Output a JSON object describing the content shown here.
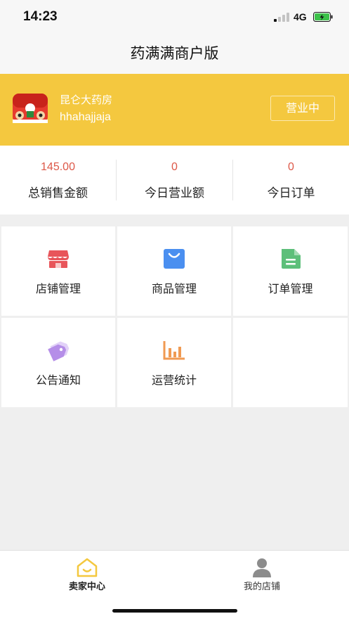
{
  "status_bar": {
    "time": "14:23",
    "network": "4G"
  },
  "nav": {
    "title": "药满满商户版"
  },
  "store": {
    "name": "昆仑大药房",
    "account": "hhahajjaja",
    "status_button": "营业中"
  },
  "stats": [
    {
      "value": "145.00",
      "label": "总销售金额"
    },
    {
      "value": "0",
      "label": "今日营业额"
    },
    {
      "value": "0",
      "label": "今日订单"
    }
  ],
  "menu": [
    {
      "label": "店铺管理",
      "icon": "store-icon"
    },
    {
      "label": "商品管理",
      "icon": "shopping-bag-icon"
    },
    {
      "label": "订单管理",
      "icon": "document-icon"
    },
    {
      "label": "公告通知",
      "icon": "tag-icon"
    },
    {
      "label": "运营统计",
      "icon": "bar-chart-icon"
    }
  ],
  "tabs": [
    {
      "label": "卖家中心",
      "icon": "home-icon",
      "active": true
    },
    {
      "label": "我的店铺",
      "icon": "user-icon",
      "active": false
    }
  ],
  "colors": {
    "banner": "#f4c83f",
    "stat_value": "#dd5848",
    "store_icon": "#e8555a",
    "bag_icon": "#4a8ff0",
    "document_icon": "#5dbf7a",
    "tag_icon": "#b58ee8",
    "chart_icon": "#f09a52",
    "tab_active_icon": "#f4c83f"
  }
}
